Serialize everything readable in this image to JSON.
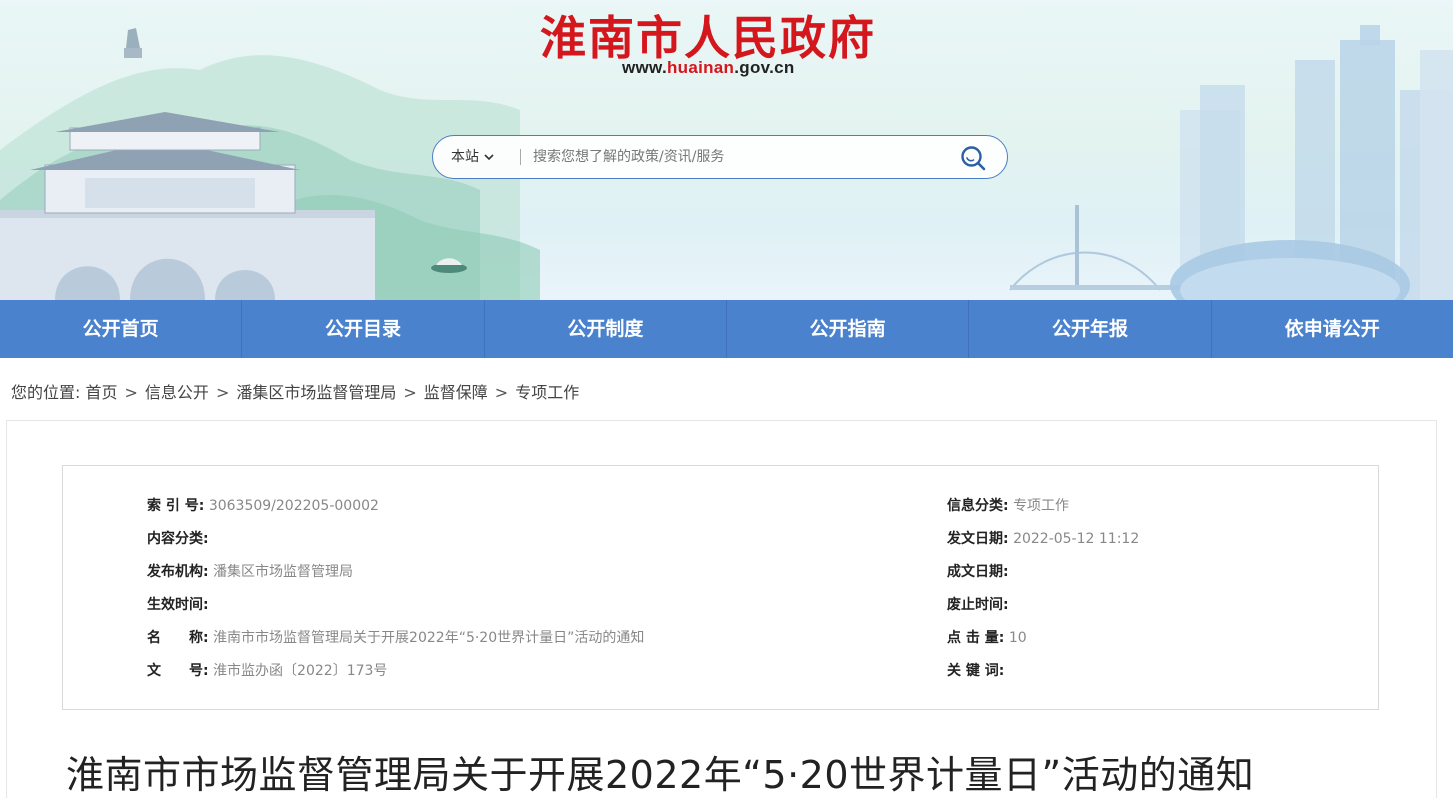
{
  "header": {
    "site_title": "淮南市人民政府",
    "site_url_prefix": "www.",
    "site_url_highlight": "huainan",
    "site_url_suffix": ".gov.cn"
  },
  "search": {
    "scope_label": "本站",
    "placeholder": "搜索您想了解的政策/资讯/服务",
    "value": ""
  },
  "nav": {
    "items": [
      "公开首页",
      "公开目录",
      "公开制度",
      "公开指南",
      "公开年报",
      "依申请公开"
    ]
  },
  "breadcrumb": {
    "prefix": "您的位置:",
    "items": [
      "首页",
      "信息公开",
      "潘集区市场监督管理局",
      "监督保障",
      "专项工作"
    ],
    "separator": ">"
  },
  "meta": {
    "index_no_label": "索 引 号:",
    "index_no_value": "3063509/202205-00002",
    "category_label": "信息分类:",
    "category_value": "专项工作",
    "content_class_label": "内容分类:",
    "content_class_value": "",
    "publish_date_label": "发文日期:",
    "publish_date_value": "2022-05-12 11:12",
    "issuer_label": "发布机构:",
    "issuer_value": "潘集区市场监督管理局",
    "created_date_label": "成文日期:",
    "created_date_value": "",
    "effective_label": "生效时间:",
    "effective_value": "",
    "expire_label": "废止时间:",
    "expire_value": "",
    "name_label": "名　　称:",
    "name_value": "淮南市市场监督管理局关于开展2022年“5·20世界计量日”活动的通知",
    "clicks_label": "点 击 量:",
    "clicks_value": "10",
    "doc_no_label": "文　　号:",
    "doc_no_value": "淮市监办函〔2022〕173号",
    "keywords_label": "关 键 词:",
    "keywords_value": ""
  },
  "article": {
    "title": "淮南市市场监督管理局关于开展2022年“5·20世界计量日”活动的通知"
  },
  "colors": {
    "brand_red": "#d4161d",
    "nav_blue": "#4b82cd",
    "search_border": "#4a7dc5"
  },
  "icons": {
    "search": "search-icon",
    "scope_dropdown": "chevron-down-icon"
  }
}
